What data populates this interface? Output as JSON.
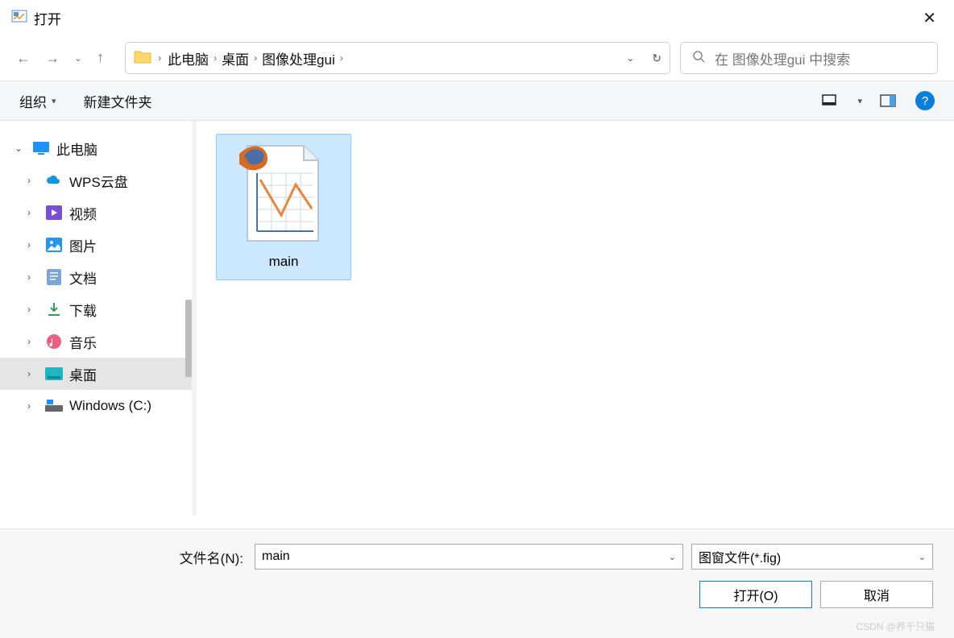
{
  "title": "打开",
  "breadcrumbs": {
    "seg1": "此电脑",
    "seg2": "桌面",
    "seg3": "图像处理gui"
  },
  "search": {
    "placeholder": "在 图像处理gui 中搜索"
  },
  "toolbar": {
    "organize": "组织",
    "new_folder": "新建文件夹"
  },
  "sidebar": {
    "root": "此电脑",
    "items": [
      {
        "label": "WPS云盘"
      },
      {
        "label": "视频"
      },
      {
        "label": "图片"
      },
      {
        "label": "文档"
      },
      {
        "label": "下载"
      },
      {
        "label": "音乐"
      },
      {
        "label": "桌面"
      },
      {
        "label": "Windows (C:)"
      }
    ]
  },
  "files": {
    "item0": "main"
  },
  "footer": {
    "filename_label": "文件名(N):",
    "filename_value": "main",
    "filter_value": "图窗文件(*.fig)",
    "open_btn": "打开(O)",
    "cancel_btn": "取消"
  },
  "watermark": "CSDN @养千只猫"
}
